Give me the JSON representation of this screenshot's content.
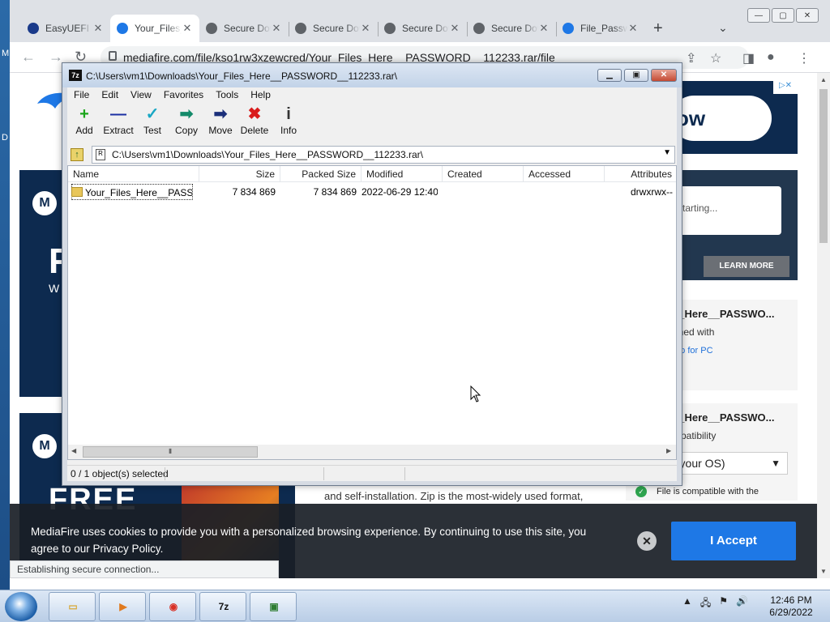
{
  "desktop": {
    "edge_letters": [
      "M",
      "D"
    ]
  },
  "browser": {
    "tabs": [
      {
        "title": "EasyUEFI",
        "icon": "app-icon",
        "color": "#1a3a8a",
        "active": false
      },
      {
        "title": "Your_Files_Here",
        "icon": "mediafire-icon",
        "color": "#1e78e6",
        "active": true
      },
      {
        "title": "Secure Download",
        "icon": "globe-icon",
        "color": "#5f6368",
        "active": false
      },
      {
        "title": "Secure Download",
        "icon": "globe-icon",
        "color": "#5f6368",
        "active": false
      },
      {
        "title": "Secure Download",
        "icon": "globe-icon",
        "color": "#5f6368",
        "active": false
      },
      {
        "title": "Secure Download",
        "icon": "globe-icon",
        "color": "#5f6368",
        "active": false
      },
      {
        "title": "File_Password",
        "icon": "mediafire-icon",
        "color": "#1e78e6",
        "active": false
      }
    ],
    "url": "mediafire.com/file/kso1rw3xzewcred/Your_Files_Here__PASSWORD__112233.rar/file",
    "status_bubble": "Establishing secure connection..."
  },
  "page": {
    "ad_top_right_text": "ow",
    "ad_mid_text": "l is starting...",
    "learn_more": "LEARN MORE",
    "card1": {
      "title": "s_Here__PASSWO...",
      "line": "ened with",
      "link": "Zip for PC"
    },
    "card2": {
      "title": "s_Here__PASSWO...",
      "line": "mpatibility"
    },
    "os_select": "s (your OS)",
    "compat_text": "File is compatible with the",
    "body_text": "and self-installation. Zip is the most-widely used format,",
    "ad_left_big": "F",
    "ad_left_free": "FREE",
    "ad_left_small": "W",
    "cookie": {
      "message": "MediaFire uses cookies to provide you with a personalized browsing experience. By continuing to use this site, you agree to our Privacy Policy.",
      "accept": "I Accept"
    }
  },
  "zip": {
    "title": "C:\\Users\\vm1\\Downloads\\Your_Files_Here__PASSWORD__112233.rar\\",
    "menu": [
      "File",
      "Edit",
      "View",
      "Favorites",
      "Tools",
      "Help"
    ],
    "tools": [
      {
        "label": "Add",
        "glyph": "+",
        "color": "#1aa51a",
        "icon": "add-icon"
      },
      {
        "label": "Extract",
        "glyph": "—",
        "color": "#1b2fa3",
        "icon": "extract-icon"
      },
      {
        "label": "Test",
        "glyph": "✓",
        "color": "#19a7c4",
        "icon": "test-icon"
      },
      {
        "label": "Copy",
        "glyph": "➡",
        "color": "#138a6a",
        "icon": "copy-icon"
      },
      {
        "label": "Move",
        "glyph": "➡",
        "color": "#1b2f7a",
        "icon": "move-icon"
      },
      {
        "label": "Delete",
        "glyph": "✖",
        "color": "#d91c1c",
        "icon": "delete-icon"
      },
      {
        "label": "Info",
        "glyph": "i",
        "color": "#333333",
        "icon": "info-icon"
      }
    ],
    "address": "C:\\Users\\vm1\\Downloads\\Your_Files_Here__PASSWORD__112233.rar\\",
    "columns": [
      "Name",
      "Size",
      "Packed Size",
      "Modified",
      "Created",
      "Accessed",
      "Attributes"
    ],
    "rows": [
      {
        "name": "Your_Files_Here__PASS...",
        "size": "7 834 869",
        "packed": "7 834 869",
        "modified": "2022-06-29 12:40",
        "created": "",
        "accessed": "",
        "attributes": "drwxrwx--"
      }
    ],
    "status": "0 / 1 object(s) selected"
  },
  "taskbar": {
    "apps": [
      {
        "name": "explorer",
        "icon": "folder-icon",
        "glyph": "▭",
        "color": "#d8a93b"
      },
      {
        "name": "media-player",
        "icon": "media-player-icon",
        "glyph": "▶",
        "color": "#e07a1f"
      },
      {
        "name": "chrome",
        "icon": "chrome-icon",
        "glyph": "◉",
        "color": "#d93025"
      },
      {
        "name": "7-zip",
        "icon": "7zip-icon",
        "glyph": "7z",
        "color": "#111111"
      },
      {
        "name": "task-manager",
        "icon": "monitor-icon",
        "glyph": "▣",
        "color": "#2e7d32"
      }
    ],
    "time": "12:46 PM",
    "date": "6/29/2022"
  }
}
